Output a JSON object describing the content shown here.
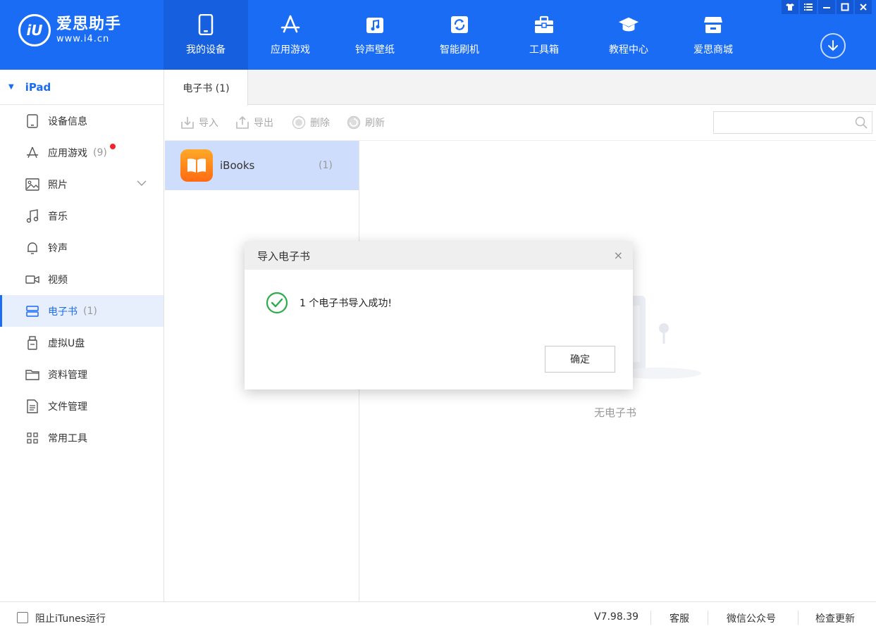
{
  "app": {
    "logo_title": "爱思助手",
    "logo_url": "www.i4.cn",
    "logo_mark": "iU"
  },
  "nav": [
    {
      "label": "我的设备",
      "icon": "phone-icon"
    },
    {
      "label": "应用游戏",
      "icon": "app-store-icon"
    },
    {
      "label": "铃声壁纸",
      "icon": "music-note-icon"
    },
    {
      "label": "智能刷机",
      "icon": "flash-icon"
    },
    {
      "label": "工具箱",
      "icon": "toolbox-icon"
    },
    {
      "label": "教程中心",
      "icon": "graduation-cap-icon"
    },
    {
      "label": "爱思商城",
      "icon": "shop-icon"
    }
  ],
  "sidebar": {
    "device": "iPad",
    "items": [
      {
        "label": "设备信息",
        "count": ""
      },
      {
        "label": "应用游戏",
        "count": "(9)"
      },
      {
        "label": "照片",
        "count": ""
      },
      {
        "label": "音乐",
        "count": ""
      },
      {
        "label": "铃声",
        "count": ""
      },
      {
        "label": "视频",
        "count": ""
      },
      {
        "label": "电子书",
        "count": "(1)"
      },
      {
        "label": "虚拟U盘",
        "count": ""
      },
      {
        "label": "资料管理",
        "count": ""
      },
      {
        "label": "文件管理",
        "count": ""
      },
      {
        "label": "常用工具",
        "count": ""
      }
    ]
  },
  "tab": {
    "label": "电子书 (1)"
  },
  "toolbar": {
    "import": "导入",
    "export": "导出",
    "delete": "删除",
    "refresh": "刷新",
    "search_placeholder": ""
  },
  "list": [
    {
      "label": "iBooks",
      "count": "(1)"
    }
  ],
  "empty": {
    "caption": "无电子书"
  },
  "statusbar": {
    "block_itunes": "阻止iTunes运行",
    "version": "V7.98.39",
    "support": "客服",
    "wechat": "微信公众号",
    "update": "检查更新"
  },
  "modal": {
    "title": "导入电子书",
    "close": "×",
    "message": "1 个电子书导入成功!",
    "ok": "确定"
  },
  "colors": {
    "brand": "#1a6cf5",
    "success": "#2dac4a",
    "selected_row": "#cfddfc",
    "badge": "#f5222d"
  }
}
